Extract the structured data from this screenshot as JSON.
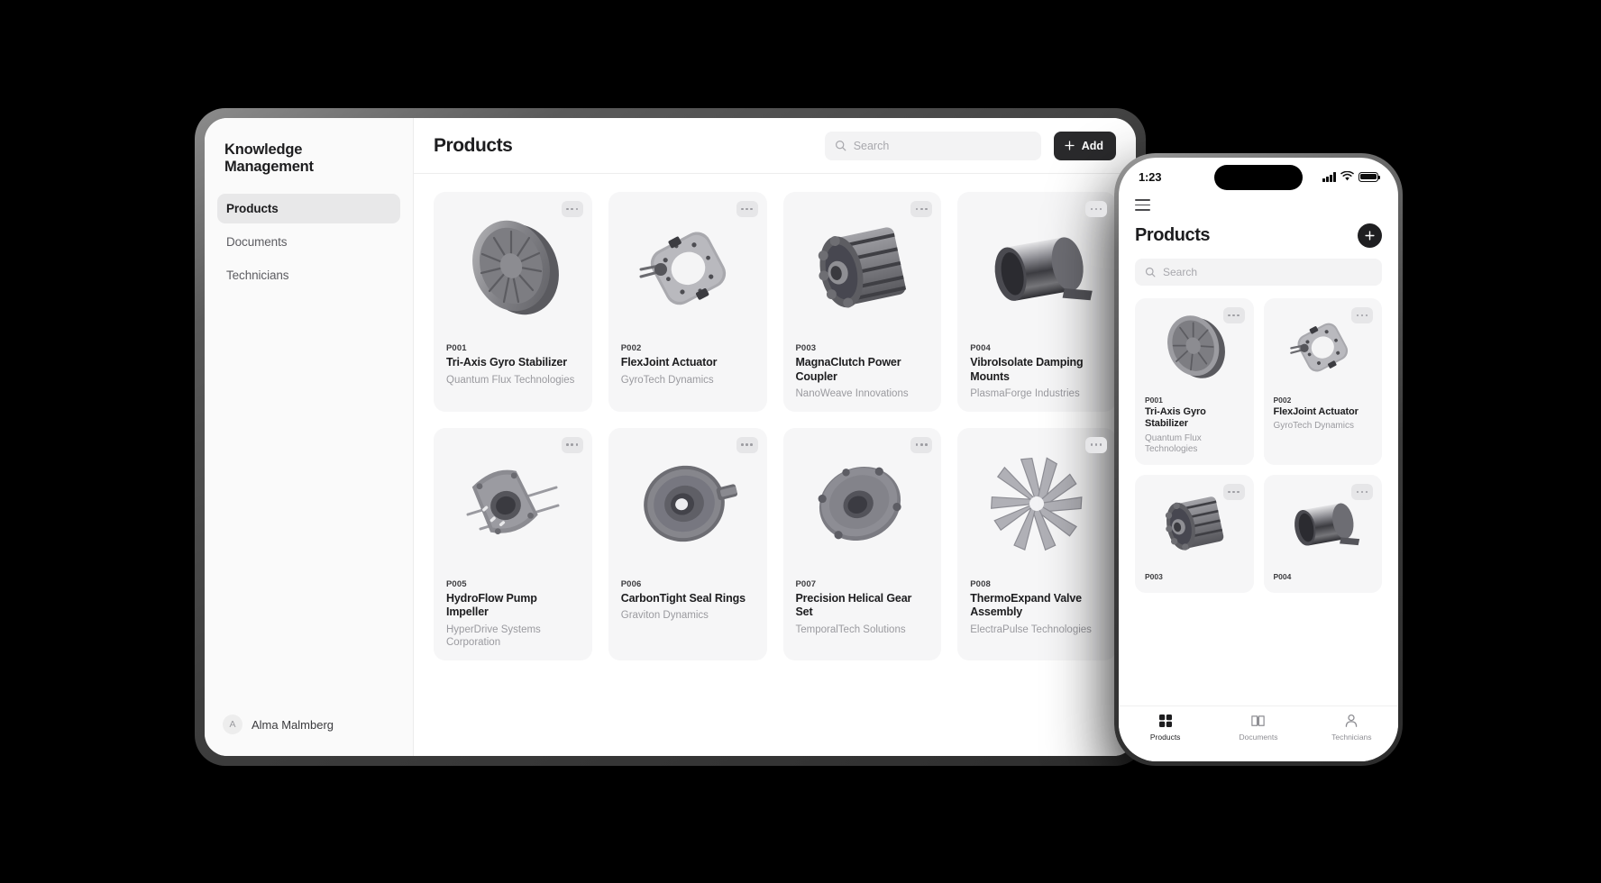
{
  "background_color": "#000000",
  "tablet": {
    "sidebar": {
      "app_title": "Knowledge Management",
      "items": [
        {
          "label": "Products",
          "active": true
        },
        {
          "label": "Documents",
          "active": false
        },
        {
          "label": "Technicians",
          "active": false
        }
      ],
      "user": {
        "initial": "A",
        "name": "Alma Malmberg"
      }
    },
    "header": {
      "title": "Products",
      "search_placeholder": "Search",
      "search_value": "",
      "add_label": "Add"
    },
    "products": [
      {
        "sku": "P001",
        "name": "Tri-Axis Gyro Stabilizer",
        "vendor": "Quantum Flux Technologies",
        "icon": "gyro-disc"
      },
      {
        "sku": "P002",
        "name": "FlexJoint Actuator",
        "vendor": "GyroTech Dynamics",
        "icon": "flex-joint"
      },
      {
        "sku": "P003",
        "name": "MagnaClutch Power Coupler",
        "vendor": "NanoWeave Innovations",
        "icon": "rotor"
      },
      {
        "sku": "P004",
        "name": "VibroIsolate Damping Mounts",
        "vendor": "PlasmaForge Industries",
        "icon": "cylinder"
      },
      {
        "sku": "P005",
        "name": "HydroFlow Pump Impeller",
        "vendor": "HyperDrive Systems Corporation",
        "icon": "pump"
      },
      {
        "sku": "P006",
        "name": "CarbonTight Seal Rings",
        "vendor": "Graviton Dynamics",
        "icon": "gear-wheel"
      },
      {
        "sku": "P007",
        "name": "Precision Helical Gear Set",
        "vendor": "TemporalTech Solutions",
        "icon": "housing"
      },
      {
        "sku": "P008",
        "name": "ThermoExpand Valve Assembly",
        "vendor": "ElectraPulse Technologies",
        "icon": "star-fan"
      }
    ]
  },
  "phone": {
    "status": {
      "time": "1:23",
      "signal": "signal-bars-icon",
      "wifi": "wifi-icon",
      "battery": "battery-full-icon"
    },
    "menu_icon": "hamburger-icon",
    "title": "Products",
    "add_icon": "plus-icon",
    "search_placeholder": "Search",
    "search_value": "",
    "products": [
      {
        "sku": "P001",
        "name": "Tri-Axis Gyro Stabilizer",
        "vendor": "Quantum Flux Technologies",
        "icon": "gyro-disc"
      },
      {
        "sku": "P002",
        "name": "FlexJoint Actuator",
        "vendor": "GyroTech Dynamics",
        "icon": "flex-joint"
      },
      {
        "sku": "P003",
        "name": "",
        "vendor": "",
        "icon": "rotor"
      },
      {
        "sku": "P004",
        "name": "",
        "vendor": "",
        "icon": "cylinder"
      }
    ],
    "tabs": [
      {
        "label": "Products",
        "icon": "grid-icon",
        "active": true
      },
      {
        "label": "Documents",
        "icon": "book-icon",
        "active": false
      },
      {
        "label": "Technicians",
        "icon": "person-icon",
        "active": false
      }
    ]
  }
}
